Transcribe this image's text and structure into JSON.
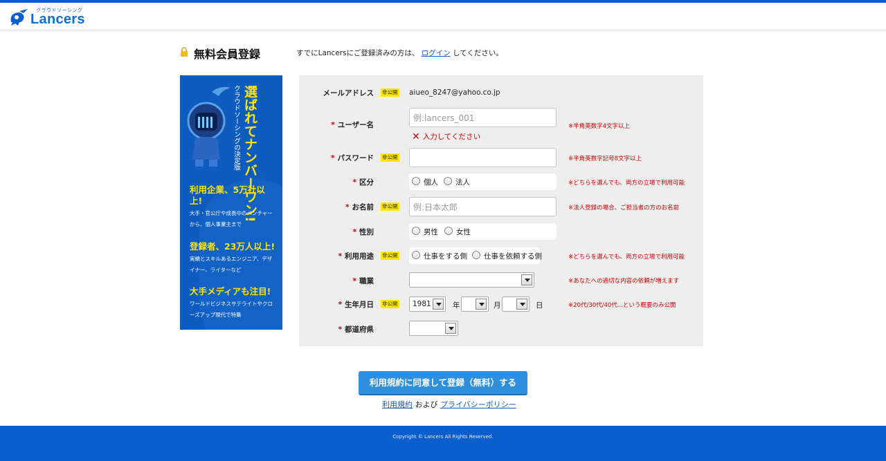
{
  "header": {
    "logo_tagline": "クラウドソーシング",
    "logo_text": "Lancers"
  },
  "title": {
    "page_title": "無料会員登録",
    "login_note_prefix": "すでにLancersにご登録済みの方は、",
    "login_link": "ログイン",
    "login_note_suffix": "してください。"
  },
  "promo": {
    "headline": "選ばれてナンバーワン!",
    "subline": "クラウドソーシングの決定版",
    "blocks": [
      {
        "title": "利用企業、5万社以上!",
        "text": "大手・官公庁や成長中のベンチャーから、個人事業主まで"
      },
      {
        "title": "登録者、23万人以上!",
        "text": "実績とスキルあるエンジニア、デザイナー、ライターなど"
      },
      {
        "title": "大手メディアも注目!",
        "text": "ワールドビジネスサテライトやクローズアップ現代で特集"
      }
    ]
  },
  "form": {
    "private_badge": "非公開",
    "required_mark": "*",
    "email": {
      "label": "メールアドレス",
      "value": "aiueo_8247@yahoo.co.jp"
    },
    "username": {
      "label": "ユーザー名",
      "placeholder": "例:lancers_001",
      "error": "入力してください",
      "hint": "※半角英数字4文字以上"
    },
    "password": {
      "label": "パスワード",
      "hint": "※半角英数字記号8文字以上"
    },
    "category": {
      "label": "区分",
      "options": [
        "個人",
        "法人"
      ],
      "hint": "※どちらを選んでも、両方の立場で利用可能"
    },
    "name": {
      "label": "お名前",
      "placeholder": "例:日本太郎",
      "hint": "※法人登録の場合、ご担当者の方のお名前"
    },
    "gender": {
      "label": "性別",
      "options": [
        "男性",
        "女性"
      ]
    },
    "usage": {
      "label": "利用用途",
      "options": [
        "仕事をする側",
        "仕事を依頼する側"
      ],
      "hint": "※どちらを選んでも、両方の立場で利用可能"
    },
    "job": {
      "label": "職業",
      "value": "",
      "hint": "※あなたへの適切な内容の依頼が増えます"
    },
    "birthday": {
      "label": "生年月日",
      "year": "1981",
      "year_unit": "年",
      "month_unit": "月",
      "day_unit": "日",
      "hint": "※20代/30代/40代...という概要のみ公開"
    },
    "prefecture": {
      "label": "都道府県",
      "value": ""
    }
  },
  "actions": {
    "submit_label": "利用規約に同意して登録（無料）する",
    "terms_link": "利用規約",
    "and_text": "および",
    "privacy_link": "プライバシーポリシー"
  },
  "footer": {
    "copyright": "Copyright © Lancers All Rights Reserved."
  },
  "colors": {
    "brand_blue": "#0b5fcc",
    "button_blue": "#2f8fdf",
    "badge_yellow": "#ffe600",
    "error_red": "#cc0000",
    "form_bg": "#eeeeee"
  }
}
